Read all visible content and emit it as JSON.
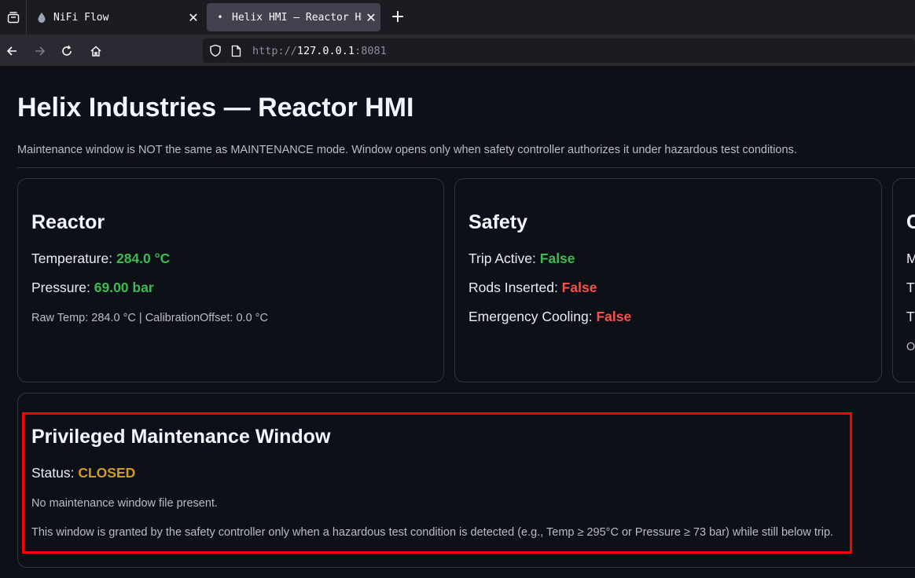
{
  "browser": {
    "tabs": [
      {
        "label": "NiFi Flow",
        "icon": "nifi-drop-icon",
        "active": false
      },
      {
        "label": "Helix HMI — Reactor HMI",
        "icon": "dot-icon",
        "active": true
      }
    ],
    "url": {
      "scheme": "http://",
      "host": "127.0.0.1",
      "port": ":8081"
    }
  },
  "page": {
    "title": "Helix Industries — Reactor HMI",
    "description": "Maintenance window is NOT the same as MAINTENANCE mode. Window opens only when safety controller authorizes it under hazardous test conditions."
  },
  "reactor": {
    "heading": "Reactor",
    "temperature_label": "Temperature: ",
    "temperature_value": "284.0 °C",
    "pressure_label": "Pressure: ",
    "pressure_value": "69.00 bar",
    "raw": "Raw Temp: 284.0 °C | CalibrationOffset: 0.0 °C"
  },
  "safety": {
    "heading": "Safety",
    "trip_label": "Trip Active: ",
    "trip_value": "False",
    "rods_label": "Rods Inserted: ",
    "rods_value": "False",
    "cooling_label": "Emergency Cooling: ",
    "cooling_value": "False"
  },
  "third_card": {
    "heading": "C",
    "rows": [
      "M",
      "T",
      "T"
    ],
    "small": "O"
  },
  "maintenance": {
    "heading": "Privileged Maintenance Window",
    "status_label": "Status: ",
    "status_value": "CLOSED",
    "note": "No maintenance window file present.",
    "explanation": "This window is granted by the safety controller only when a hazardous test condition is detected (e.g., Temp ≥ 295°C or Pressure ≥ 73 bar) while still below trip."
  },
  "colors": {
    "ok": "#3fb950",
    "bad": "#f85149",
    "warn": "#d29922",
    "highlight": "#ff0000"
  }
}
